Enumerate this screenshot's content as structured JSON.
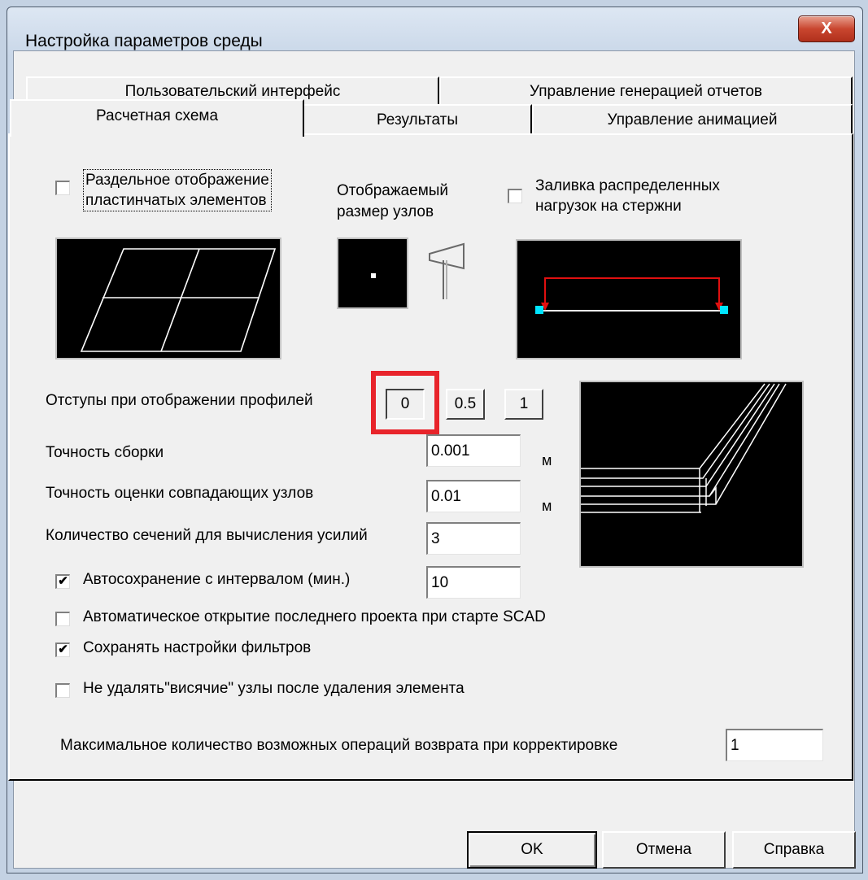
{
  "window": {
    "title": "Настройка параметров среды",
    "close_glyph": "X"
  },
  "tabs": {
    "back": [
      "Пользовательский интерфейс",
      "Управление генерацией отчетов"
    ],
    "front": [
      "Расчетная схема",
      "Результаты",
      "Управление анимацией"
    ],
    "active": "Расчетная схема"
  },
  "options": {
    "separate_plates": {
      "label_line1": "Раздельное отображение",
      "label_line2": "пластинчатых элементов",
      "checked": false
    },
    "node_size": {
      "label_line1": "Отображаемый",
      "label_line2": "размер  узлов"
    },
    "fill_loads": {
      "label_line1": "Заливка распределенных",
      "label_line2": "нагрузок на стержни",
      "checked": false
    }
  },
  "profiles": {
    "label": "Отступы при отображении профилей",
    "buttons": [
      "0",
      "0.5",
      "1"
    ],
    "selected": "0"
  },
  "assembly": {
    "label": "Точность сборки",
    "value": "0.001",
    "unit": "м"
  },
  "coincident": {
    "label": "Точность оценки совпадающих узлов",
    "value": "0.01",
    "unit": "м"
  },
  "sections": {
    "label": "Количество сечений для вычисления усилий",
    "value": "3"
  },
  "autosave": {
    "label": "Автосохранение с интервалом (мин.)",
    "value": "10",
    "checked": true
  },
  "autoopen": {
    "label": "Автоматическое открытие последнего проекта при старте SCAD",
    "checked": false
  },
  "filters": {
    "label": "Сохранять настройки фильтров",
    "checked": true
  },
  "hanging": {
    "label": "Не удалять\"висячие\" узлы после удаления элемента",
    "checked": false
  },
  "undo": {
    "label": "Максимальное количество возможных операций возврата при корректировке",
    "value": "1"
  },
  "footer": {
    "ok": "OK",
    "cancel": "Отмена",
    "help": "Справка"
  },
  "check_glyph": "✔",
  "colors": {
    "highlight": "#e8242b",
    "load_red": "#e01010",
    "node_cyan": "#00e5ff"
  }
}
